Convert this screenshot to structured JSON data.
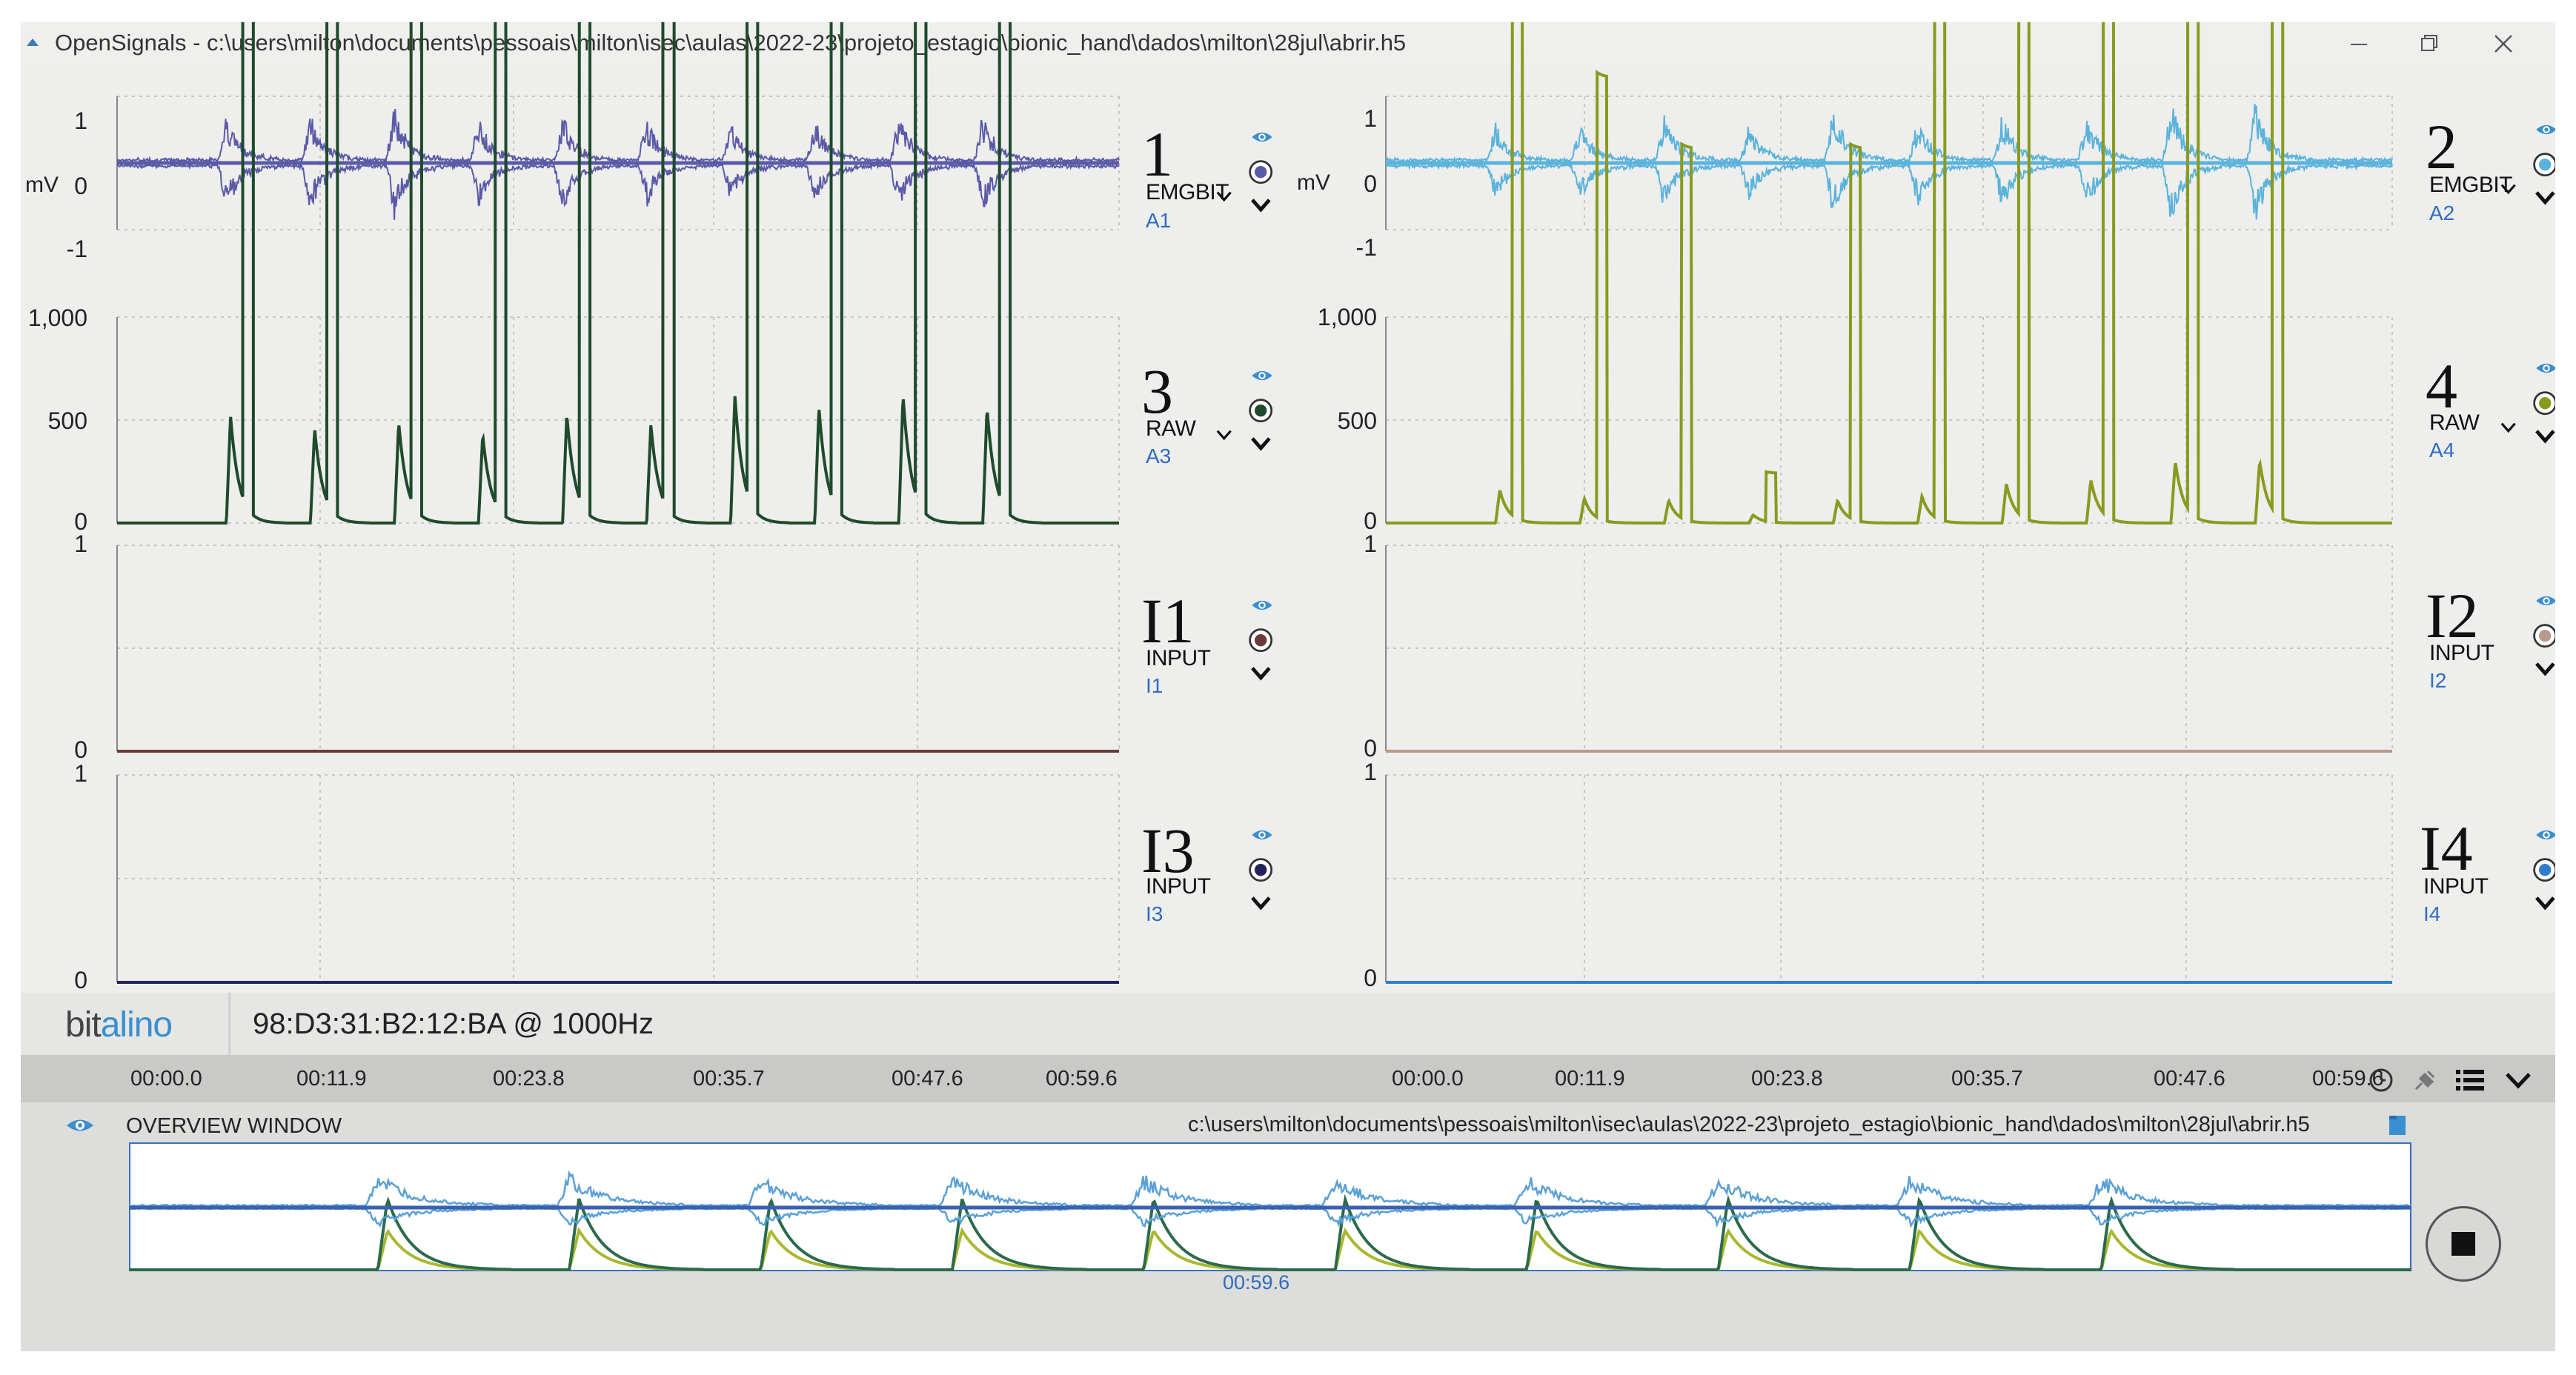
{
  "window": {
    "title": "OpenSignals - c:\\users\\milton\\documents\\pessoais\\milton\\isec\\aulas\\2022-23\\projeto_estagio\\bionic_hand\\dados\\milton\\28jul\\abrir.h5"
  },
  "channels": [
    {
      "number": "1",
      "type": "EMGBIT",
      "source": "A1",
      "color": "#5a5aa8",
      "ymax": "1",
      "ymid": "0",
      "ymin": "-1",
      "unit": "mV"
    },
    {
      "number": "2",
      "type": "EMGBIT",
      "source": "A2",
      "color": "#5ab3dc",
      "ymax": "1",
      "ymid": "0",
      "ymin": "-1",
      "unit": "mV"
    },
    {
      "number": "3",
      "type": "RAW",
      "source": "A3",
      "color": "#1f4a2c",
      "ymax": "1,000",
      "ymid": "500",
      "ymin": "0"
    },
    {
      "number": "4",
      "type": "RAW",
      "source": "A4",
      "color": "#8a9a1e",
      "ymax": "1,000",
      "ymid": "500",
      "ymin": "0"
    },
    {
      "number": "I1",
      "type": "INPUT",
      "source": "I1",
      "color": "#6a3a3a",
      "ymax": "1",
      "ymin": "0"
    },
    {
      "number": "I2",
      "type": "INPUT",
      "source": "I2",
      "color": "#b89a8c",
      "ymax": "1",
      "ymin": "0"
    },
    {
      "number": "I3",
      "type": "INPUT",
      "source": "I3",
      "color": "#23235a",
      "ymax": "1",
      "ymin": "0"
    },
    {
      "number": "I4",
      "type": "INPUT",
      "source": "I4",
      "color": "#2f7fd0",
      "ymax": "1",
      "ymin": "0"
    }
  ],
  "device": {
    "logo_main": "bit",
    "logo_accent": "alino",
    "address": "98:D3:31:B2:12:BA @ 1000Hz"
  },
  "time_axis": {
    "left": [
      "00:00.0",
      "00:11.9",
      "00:23.8",
      "00:35.7",
      "00:47.6",
      "00:59.6"
    ],
    "right": [
      "00:00.0",
      "00:11.9",
      "00:23.8",
      "00:35.7",
      "00:47.6",
      "00:59.6"
    ]
  },
  "overview": {
    "title": "OVERVIEW WINDOW",
    "path": "c:\\users\\milton\\documents\\pessoais\\milton\\isec\\aulas\\2022-23\\projeto_estagio\\bionic_hand\\dados\\milton\\28jul\\abrir.h5",
    "cursor_time": "00:59.6"
  },
  "icons": {
    "eye": "eye-icon",
    "record": "record-icon",
    "dropdown": "chevron-down-icon",
    "clock": "clock-icon",
    "plug": "plug-icon",
    "list": "list-icon",
    "folder": "folder-icon",
    "stop": "stop-icon"
  },
  "signal": {
    "bursts": 10,
    "burst_times_s": [
      6.5,
      11.5,
      16.5,
      21.5,
      26.5,
      31.5,
      36.5,
      41.5,
      46.5,
      51.5
    ]
  }
}
